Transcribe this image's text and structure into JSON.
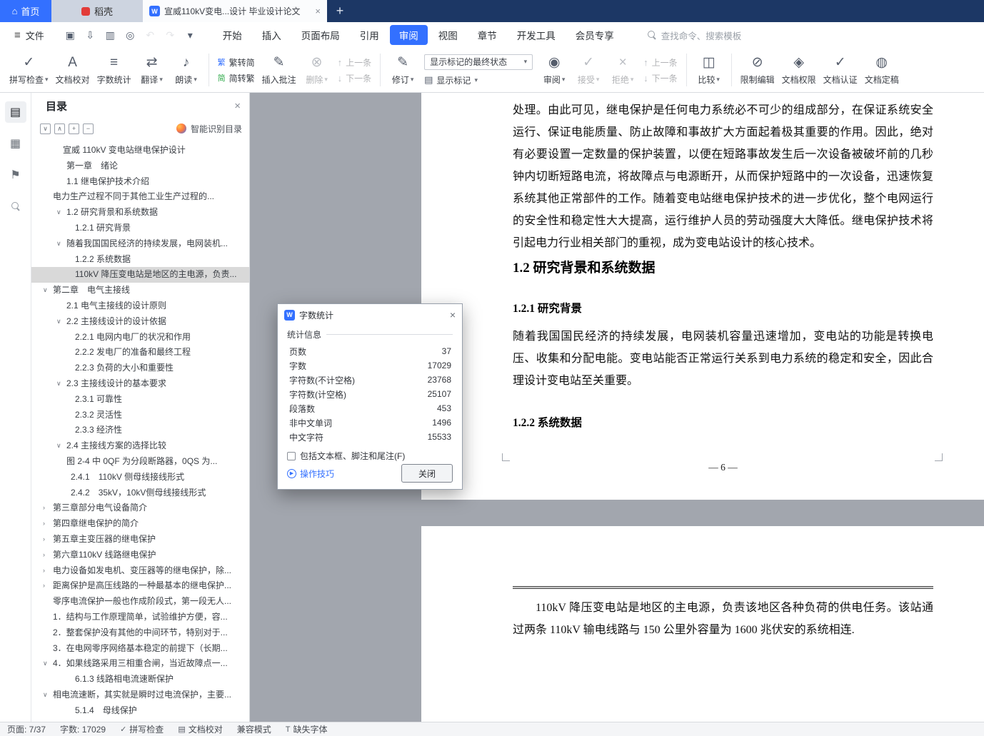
{
  "icons": {
    "home": "⌂",
    "menu": "≡",
    "close": "×",
    "w": "W",
    "play": "▶",
    "caret": "▾",
    "save": "▣",
    "export": "⇩",
    "print": "▥",
    "print-preview": "◎",
    "undo": "↶",
    "redo": "↷",
    "more": "▾",
    "spellcheck": "✓",
    "proofread": "A",
    "word-count": "≡",
    "translate": "⇄",
    "read-aloud": "♪",
    "trad-simp": "繁",
    "simp-trad": "简",
    "insert-comment": "✎",
    "delete-comment": "⊗",
    "prev": "↑",
    "next": "↓",
    "revise": "✎",
    "show-marks": "▤",
    "review": "◉",
    "accept": "✓",
    "reject": "×",
    "compare": "◫",
    "restrict-edit": "⊘",
    "doc-permission": "◈",
    "doc-certify": "✓",
    "doc-final": "◍",
    "outline": "▤",
    "checklist": "▦",
    "bookmark": "⚑",
    "expand-all": "∨",
    "collapse-all": "∧",
    "plus": "+",
    "minus": "−",
    "spell-status": "✓",
    "proof-status": "▤",
    "missing-font": "T",
    "chev-down": "∨",
    "chev-right": "›"
  },
  "tabbar": {
    "home_label": "首页",
    "docer_label": "稻壳",
    "doc_label": "宣威110kV变电...设计 毕业设计论文",
    "new_tab": "+"
  },
  "menubar": {
    "file_label": "文件",
    "quick_icons": [
      {
        "name": "save"
      },
      {
        "name": "export"
      },
      {
        "name": "print"
      },
      {
        "name": "print-preview"
      },
      {
        "name": "undo",
        "disabled": true
      },
      {
        "name": "redo",
        "disabled": true
      },
      {
        "name": "more"
      }
    ],
    "tabs": [
      "开始",
      "插入",
      "页面布局",
      "引用",
      "审阅",
      "视图",
      "章节",
      "开发工具",
      "会员专享"
    ],
    "active_index": 4,
    "search_placeholder": "查找命令、搜索模板"
  },
  "toolbar": {
    "cells": [
      {
        "type": "big",
        "icon": "spellcheck",
        "label": "拼写检查",
        "caret": true
      },
      {
        "type": "big",
        "icon": "proofread",
        "label": "文档校对"
      },
      {
        "type": "big",
        "icon": "word-count",
        "label": "字数统计"
      },
      {
        "type": "big",
        "icon": "translate",
        "label": "翻译",
        "caret": true
      },
      {
        "type": "big",
        "icon": "read-aloud",
        "label": "朗读",
        "caret": true
      },
      {
        "type": "sep"
      },
      {
        "type": "stack",
        "items": [
          {
            "icon": "trad-simp",
            "label": "繁转简"
          },
          {
            "icon": "simp-trad",
            "label": "简转繁"
          }
        ]
      },
      {
        "type": "big",
        "icon": "insert-comment",
        "label": "插入批注"
      },
      {
        "type": "big",
        "icon": "delete-comment",
        "label": "删除",
        "caret": true,
        "disabled": true
      },
      {
        "type": "stack",
        "items": [
          {
            "icon": "prev",
            "label": "上一条",
            "disabled": true
          },
          {
            "icon": "next",
            "label": "下一条",
            "disabled": true
          }
        ]
      },
      {
        "type": "sep"
      },
      {
        "type": "big",
        "icon": "revise",
        "label": "修订",
        "caret": true
      },
      {
        "type": "combo",
        "combo_value": "显示标记的最终状态",
        "below_icon": "show-marks",
        "below_label": "显示标记",
        "below_caret": true
      },
      {
        "type": "big",
        "icon": "review",
        "label": "审阅",
        "caret": true
      },
      {
        "type": "big",
        "icon": "accept",
        "label": "接受",
        "caret": true,
        "disabled": true
      },
      {
        "type": "big",
        "icon": "reject",
        "label": "拒绝",
        "caret": true,
        "disabled": true
      },
      {
        "type": "stack",
        "items": [
          {
            "icon": "prev",
            "label": "上一条",
            "disabled": true
          },
          {
            "icon": "next",
            "label": "下一条",
            "disabled": true
          }
        ]
      },
      {
        "type": "sep"
      },
      {
        "type": "big",
        "icon": "compare",
        "label": "比较",
        "caret": true
      },
      {
        "type": "sep"
      },
      {
        "type": "big",
        "icon": "restrict-edit",
        "label": "限制编辑"
      },
      {
        "type": "big",
        "icon": "doc-permission",
        "label": "文档权限"
      },
      {
        "type": "big",
        "icon": "doc-certify",
        "label": "文档认证"
      },
      {
        "type": "big",
        "icon": "doc-final",
        "label": "文档定稿"
      }
    ]
  },
  "sidebar": {
    "icons": [
      {
        "name": "outline",
        "active": true
      },
      {
        "name": "checklist"
      },
      {
        "name": "bookmark"
      },
      {
        "name": "search"
      }
    ]
  },
  "toc": {
    "title": "目录",
    "smart_label": "智能识别目录",
    "tools": [
      {
        "name": "expand-all",
        "icon": "expand-all"
      },
      {
        "name": "collapse-all",
        "icon": "collapse-all"
      },
      {
        "name": "expand-level",
        "icon": "plus"
      },
      {
        "name": "collapse-level",
        "icon": "minus"
      }
    ],
    "items": [
      {
        "label": "宣威 110kV 变电站继电保护设计",
        "indent": 44,
        "chev": "none"
      },
      {
        "label": "第一章　绪论",
        "indent": 49,
        "chev": "none"
      },
      {
        "label": "1.1 继电保护技术介绍",
        "indent": 49,
        "chev": "none"
      },
      {
        "label": "电力生产过程不同于其他工业生产过程的...",
        "indent": 30,
        "chev": "none"
      },
      {
        "label": "1.2 研究背景和系统数据",
        "indent": 49,
        "chev": "down"
      },
      {
        "label": "1.2.1 研究背景",
        "indent": 61,
        "chev": "none"
      },
      {
        "label": "随着我国国民经济的持续发展，电网装机...",
        "indent": 49,
        "chev": "down"
      },
      {
        "label": "1.2.2 系统数据",
        "indent": 61,
        "chev": "none"
      },
      {
        "label": "110kV 降压变电站是地区的主电源，负责...",
        "indent": 61,
        "chev": "none",
        "selected": true
      },
      {
        "label": "第二章　电气主接线",
        "indent": 30,
        "chev": "down"
      },
      {
        "label": "2.1 电气主接线的设计原则",
        "indent": 49,
        "chev": "none"
      },
      {
        "label": "2.2 主接线设计的设计依据",
        "indent": 49,
        "chev": "down"
      },
      {
        "label": "2.2.1 电网内电厂的状况和作用",
        "indent": 61,
        "chev": "none"
      },
      {
        "label": "2.2.2 发电厂的准备和最终工程",
        "indent": 61,
        "chev": "none"
      },
      {
        "label": "2.2.3 负荷的大小和重要性",
        "indent": 61,
        "chev": "none"
      },
      {
        "label": "2.3 主接线设计的基本要求",
        "indent": 49,
        "chev": "down"
      },
      {
        "label": "2.3.1 可靠性",
        "indent": 61,
        "chev": "none"
      },
      {
        "label": "2.3.2 灵活性",
        "indent": 61,
        "chev": "none"
      },
      {
        "label": "2.3.3 经济性",
        "indent": 61,
        "chev": "none"
      },
      {
        "label": "2.4 主接线方案的选择比较",
        "indent": 49,
        "chev": "down"
      },
      {
        "label": "图 2-4 中 0QF 为分段断路器，0QS 为...",
        "indent": 49,
        "chev": "none"
      },
      {
        "label": "2.4.1　110kV 侧母线接线形式",
        "indent": 55,
        "chev": "none"
      },
      {
        "label": "2.4.2　35kV，10kV侧母线接线形式",
        "indent": 55,
        "chev": "none"
      },
      {
        "label": "第三章部分电气设备简介",
        "indent": 30,
        "chev": "right"
      },
      {
        "label": "第四章继电保护的简介",
        "indent": 30,
        "chev": "right"
      },
      {
        "label": "第五章主变压器的继电保护",
        "indent": 30,
        "chev": "right"
      },
      {
        "label": "第六章110kV 线路继电保护",
        "indent": 30,
        "chev": "right"
      },
      {
        "label": "电力设备如发电机、变压器等的继电保护，除...",
        "indent": 30,
        "chev": "right"
      },
      {
        "label": "距离保护是高压线路的一种最基本的继电保护...",
        "indent": 30,
        "chev": "right"
      },
      {
        "label": "零序电流保护一般也作成阶段式，第一段无人...",
        "indent": 30,
        "chev": "none"
      },
      {
        "label": "1．结构与工作原理简单，试验维护方便，容...",
        "indent": 30,
        "chev": "none"
      },
      {
        "label": "2．整套保护没有其他的中间环节，特别对于...",
        "indent": 30,
        "chev": "none"
      },
      {
        "label": "3．在电网零序网络基本稳定的前提下（长期...",
        "indent": 30,
        "chev": "none"
      },
      {
        "label": "4．如果线路采用三相重合闸，当近故障点一...",
        "indent": 30,
        "chev": "down"
      },
      {
        "label": "6.1.3 线路相电流速断保护",
        "indent": 61,
        "chev": "none"
      },
      {
        "label": "相电流速断，其实就是瞬时过电流保护，主要...",
        "indent": 30,
        "chev": "down"
      },
      {
        "label": "5.1.4　母线保护",
        "indent": 61,
        "chev": "none"
      }
    ]
  },
  "docpages": {
    "page1": {
      "para1": "处理。由此可见，继电保护是任何电力系统必不可少的组成部分，在保证系统安全运行、保证电能质量、防止故障和事故扩大方面起着极其重要的作用。因此，绝对有必要设置一定数量的保护装置，以便在短路事故发生后一次设备被破坏前的几秒钟内切断短路电流，将故障点与电源断开，从而保护短路中的一次设备，迅速恢复系统其他正常部件的工作。随着变电站继电保护技术的进一步优化，整个电网运行的安全性和稳定性大大提高，运行维护人员的劳动强度大大降低。继电保护技术将引起电力行业相关部门的重视，成为变电站设计的核心技术。",
      "h1": "1.2  研究背景和系统数据",
      "h2": "1.2.1 研究背景",
      "para2": "随着我国国民经济的持续发展，电网装机容量迅速增加，变电站的功能是转换电压、收集和分配电能。变电站能否正常运行关系到电力系统的稳定和安全，因此合理设计变电站至关重要。",
      "h3": "1.2.2 系统数据",
      "page_no": "— 6 —"
    },
    "page2": {
      "para1": "110kV 降压变电站是地区的主电源，负责该地区各种负荷的供电任务。该站通过两条 110kV 输电线路与 150 公里外容量为 1600 兆伏安的系统相连."
    }
  },
  "wordcount": {
    "title": "字数统计",
    "section_label": "统计信息",
    "rows": [
      {
        "label": "页数",
        "value": "37"
      },
      {
        "label": "字数",
        "value": "17029"
      },
      {
        "label": "字符数(不计空格)",
        "value": "23768"
      },
      {
        "label": "字符数(计空格)",
        "value": "25107"
      },
      {
        "label": "段落数",
        "value": "453"
      },
      {
        "label": "非中文单词",
        "value": "1496"
      },
      {
        "label": "中文字符",
        "value": "15533"
      }
    ],
    "checkbox_label": "包括文本框、脚注和尾注(F)",
    "checkbox_checked": false,
    "tips_label": "操作技巧",
    "close_label": "关闭"
  },
  "statusbar": {
    "items": [
      {
        "name": "page-indicator",
        "label": "页面: 7/37"
      },
      {
        "name": "word-count-indicator",
        "label": "字数: 17029"
      },
      {
        "name": "spellcheck-status",
        "icon": "spell-status",
        "label": "拼写检查"
      },
      {
        "name": "proofread-status",
        "icon": "proof-status",
        "label": "文档校对"
      },
      {
        "name": "compat-mode",
        "label": "兼容模式"
      },
      {
        "name": "missing-font",
        "icon": "missing-font",
        "label": "缺失字体"
      }
    ]
  }
}
